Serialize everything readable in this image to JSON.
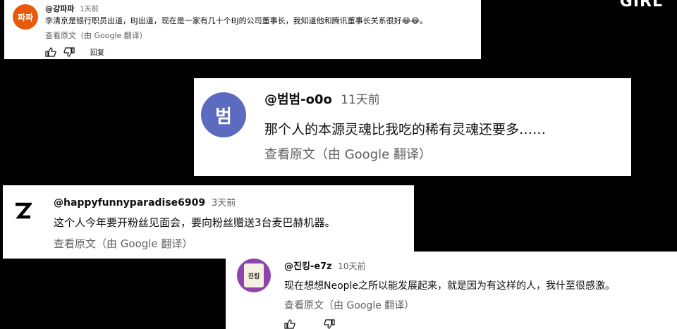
{
  "watermark": "GIRL",
  "comments": [
    {
      "avatar_text": "파파",
      "avatar_color": "#e8590c",
      "handle": "@강파파",
      "time": "1天前",
      "text": "李清京是银行职员出道，BJ出道，现在是一家有几十个BJ的公司董事长，我知道他和腾讯董事长关系很好😂😂。",
      "translate": "查看原文（由 Google 翻译）",
      "reply": "回复"
    },
    {
      "avatar_text": "범",
      "avatar_color": "#5c6bc0",
      "handle": "@범범-o0o",
      "time": "11天前",
      "text": "那个人的本源灵魂比我吃的稀有灵魂还要多……",
      "translate": "查看原文（由 Google 翻译）"
    },
    {
      "avatar_text": "Z",
      "avatar_color": "#ffffff",
      "handle": "@happyfunnyparadise6909",
      "time": "3天前",
      "text": "这个人今年要开粉丝见面会，要向粉丝赠送3台麦巴赫机器。",
      "translate": "查看原文（由 Google 翻译）"
    },
    {
      "avatar_text": "진킹",
      "avatar_color": "#8e44ad",
      "handle": "@진킹-e7z",
      "time": "10天前",
      "text": "现在想想Neople之所以能发展起来，就是因为有这样的人，我什至很感激。",
      "translate": "查看原文（由 Google 翻译）"
    }
  ]
}
